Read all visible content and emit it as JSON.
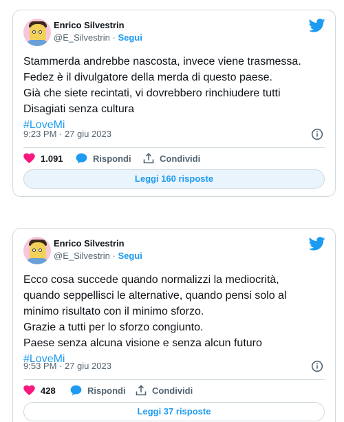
{
  "tweets": [
    {
      "author": {
        "name": "Enrico Silvestrin",
        "handle": "@E_Silvestrin",
        "separator": "·",
        "follow_label": "Segui"
      },
      "text_lines": [
        "Stammerda andrebbe nascosta, invece viene trasmessa.",
        "Fedez è il divulgatore della merda di questo paese.",
        "Già che siete recintati, vi dovrebbero rinchiudere tutti",
        "Disagiati senza cultura"
      ],
      "hashtag": "#LoveMi",
      "timestamp": "9:23 PM · 27 giu 2023",
      "likes": "1.091",
      "reply_label": "Rispondi",
      "share_label": "Condividi",
      "replies_button": "Leggi 160 risposte"
    },
    {
      "author": {
        "name": "Enrico Silvestrin",
        "handle": "@E_Silvestrin",
        "separator": "·",
        "follow_label": "Segui"
      },
      "text_lines": [
        "Ecco cosa succede quando normalizzi la mediocrità,",
        "quando seppellisci le alternative, quando pensi solo al",
        "minimo risultato con il minimo sforzo.",
        "Grazie a tutti per lo sforzo congiunto.",
        "Paese senza alcuna visione e senza alcun futuro"
      ],
      "hashtag": "#LoveMi",
      "timestamp": "9:53 PM · 27 giu 2023",
      "likes": "428",
      "reply_label": "Rispondi",
      "share_label": "Condividi",
      "replies_button": "Leggi 37 risposte"
    }
  ],
  "icons": {
    "brand": "twitter-bird-icon",
    "like": "heart-icon",
    "reply": "speech-bubble-icon",
    "share": "share-upload-icon",
    "info": "info-icon"
  },
  "colors": {
    "accent": "#1d9bf0",
    "like": "#f91880",
    "text": "#0f1419",
    "secondary": "#536471",
    "border": "#cfd9de"
  }
}
